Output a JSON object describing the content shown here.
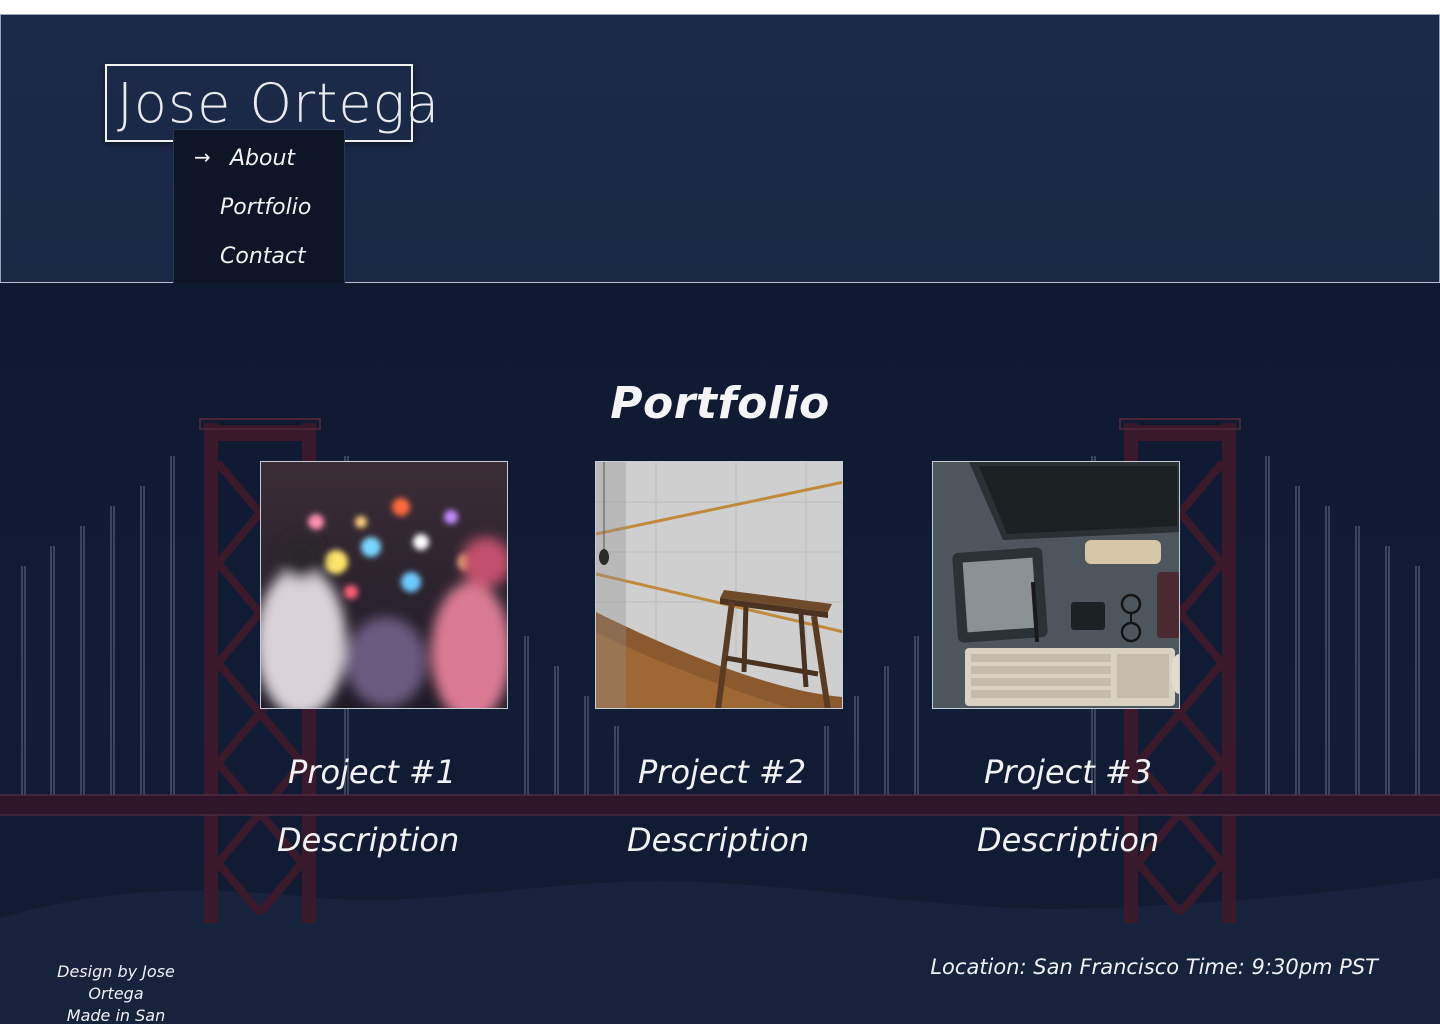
{
  "site": {
    "logo": "Jose Ortega"
  },
  "nav": {
    "items": [
      {
        "label": "About",
        "active": true
      },
      {
        "label": "Portfolio",
        "active": false
      },
      {
        "label": "Contact",
        "active": false
      }
    ],
    "active_icon": "arrow-right-icon"
  },
  "portfolio": {
    "title": "Portfolio",
    "projects": [
      {
        "title": "Project #1",
        "description": "Description",
        "image": "blurred-night-street-photo"
      },
      {
        "title": "Project #2",
        "description": "Description",
        "image": "wooden-stool-photo"
      },
      {
        "title": "Project #3",
        "description": "Description",
        "image": "desk-devices-flatlay-photo"
      }
    ]
  },
  "footer": {
    "credit_line1": "Design by Jose Ortega",
    "credit_line2": "Made in San Francisco",
    "location_time": "Location: San Francisco Time: 9:30pm PST"
  },
  "colors": {
    "header_bg": "#1c2a4a",
    "main_bg": "#0f1932",
    "nav_bg": "#0e1526",
    "bridge_red": "#3a1a2a"
  }
}
